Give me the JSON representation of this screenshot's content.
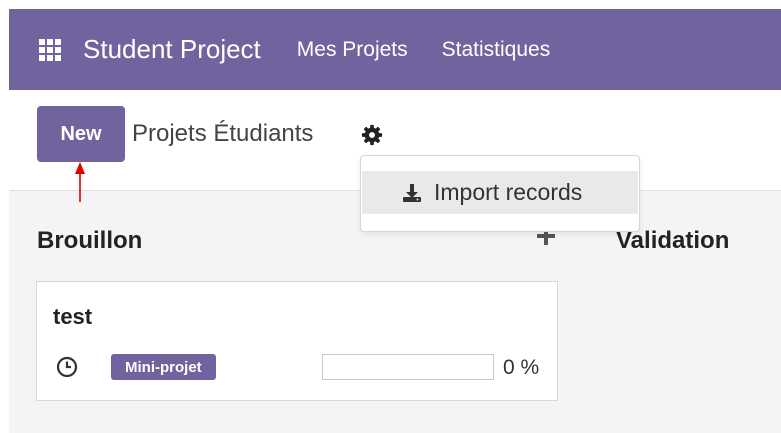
{
  "navbar": {
    "brand": "Student Project",
    "menu": [
      "Mes Projets",
      "Statistiques"
    ]
  },
  "control": {
    "new_label": "New",
    "title": "Projets Étudiants"
  },
  "dropdown": {
    "items": [
      "Import records"
    ]
  },
  "kanban": {
    "columns": [
      "Brouillon",
      "Validation"
    ],
    "cards": [
      {
        "title": "test",
        "tag": "Mini-projet",
        "progress": 0,
        "progress_text": "0 %"
      }
    ]
  },
  "colors": {
    "primary": "#71639e",
    "background": "#f4f4f6",
    "annotation": "#e00000"
  },
  "icons": [
    "apps-grid-icon",
    "gear-icon",
    "download-icon",
    "plus-icon",
    "clock-icon"
  ]
}
